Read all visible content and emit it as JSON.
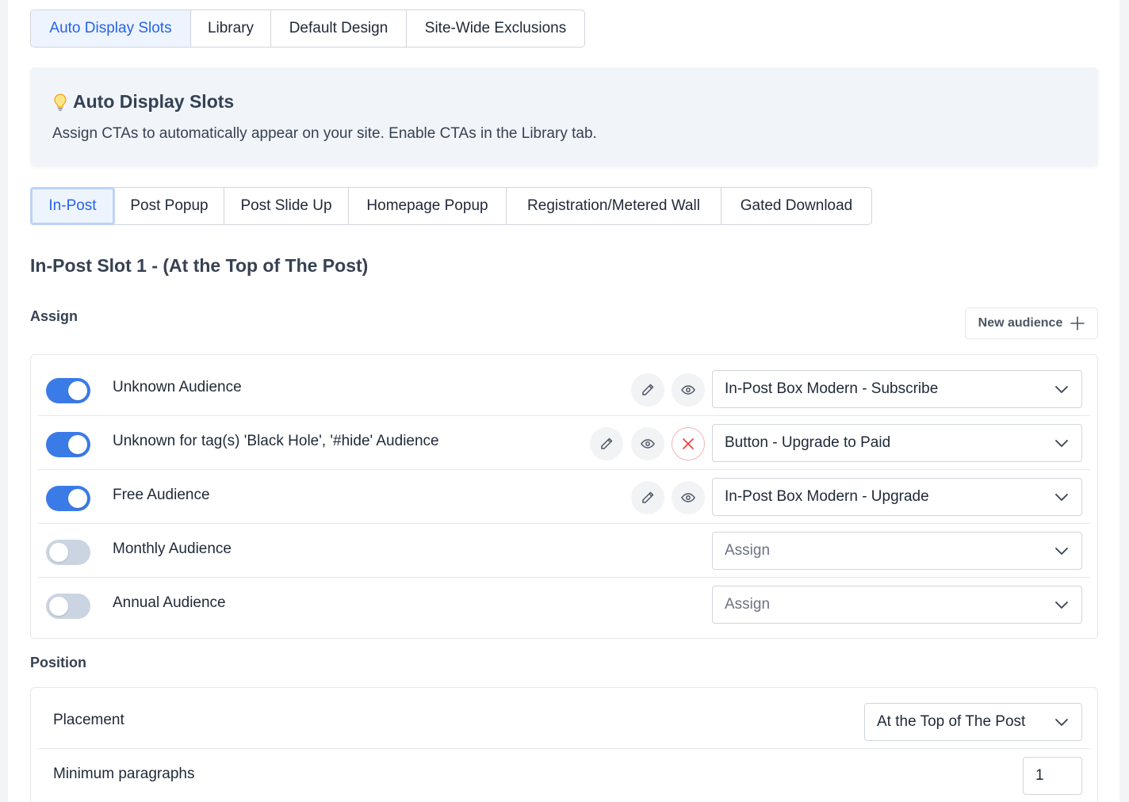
{
  "top_tabs": [
    {
      "label": "Auto Display Slots",
      "active": true
    },
    {
      "label": "Library",
      "active": false
    },
    {
      "label": "Default Design",
      "active": false
    },
    {
      "label": "Site-Wide Exclusions",
      "active": false
    }
  ],
  "info": {
    "icon": "lightbulb-icon",
    "title": "Auto Display Slots",
    "description": "Assign CTAs to automatically appear on your site. Enable CTAs in the Library tab."
  },
  "sub_tabs": [
    {
      "label": "In-Post",
      "active": true
    },
    {
      "label": "Post Popup",
      "active": false
    },
    {
      "label": "Post Slide Up",
      "active": false
    },
    {
      "label": "Homepage Popup",
      "active": false
    },
    {
      "label": "Registration/Metered Wall",
      "active": false
    },
    {
      "label": "Gated Download",
      "active": false
    }
  ],
  "slot_title": "In-Post Slot 1 - (At the Top of The Post)",
  "assign": {
    "label": "Assign",
    "new_audience_label": "New audience",
    "rows": [
      {
        "label": "Unknown Audience",
        "enabled": true,
        "select_value": "In-Post Box Modern - Subscribe"
      },
      {
        "label": "Unknown for tag(s) 'Black Hole', '#hide' Audience",
        "enabled": true,
        "select_value": "Button - Upgrade to Paid"
      },
      {
        "label": "Free Audience",
        "enabled": true,
        "select_value": "In-Post Box Modern - Upgrade"
      },
      {
        "label": "Monthly Audience",
        "enabled": false,
        "select_placeholder": "Assign"
      },
      {
        "label": "Annual Audience",
        "enabled": false,
        "select_placeholder": "Assign"
      }
    ]
  },
  "position": {
    "label": "Position",
    "placement_label": "Placement",
    "placement_value": "At the Top of The Post",
    "min_paragraphs_label": "Minimum paragraphs",
    "min_paragraphs_value": "1"
  },
  "colors": {
    "accent": "#2563eb",
    "toggle_on": "#3b7be8",
    "toggle_off": "#cbd5e1",
    "danger": "#ef4444"
  }
}
